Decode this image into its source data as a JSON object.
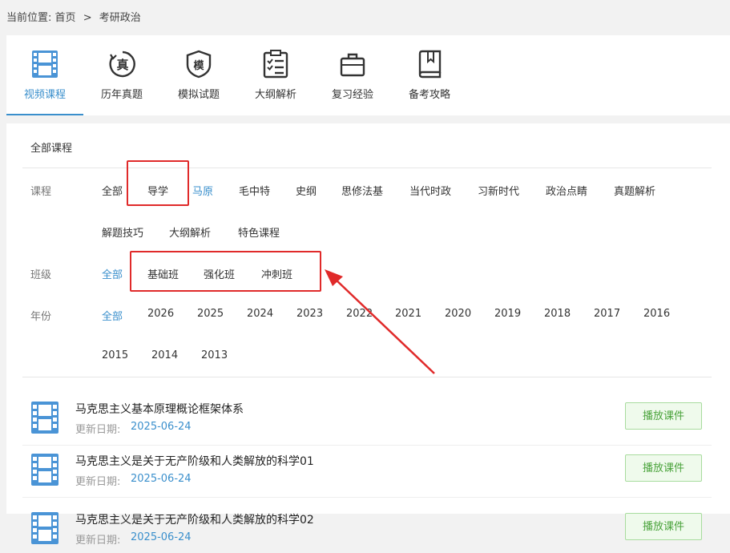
{
  "breadcrumb": {
    "prefix": "当前位置:",
    "home": "首页",
    "separator": ">",
    "current": "考研政治"
  },
  "tabs": [
    {
      "label": "视频课程",
      "icon": "film-icon",
      "active": true
    },
    {
      "label": "历年真题",
      "icon": "zhen-badge-icon"
    },
    {
      "label": "模拟试题",
      "icon": "mo-shield-icon"
    },
    {
      "label": "大纲解析",
      "icon": "checklist-icon"
    },
    {
      "label": "复习经验",
      "icon": "briefcase-icon"
    },
    {
      "label": "备考攻略",
      "icon": "book-icon"
    }
  ],
  "filters": {
    "all_courses": "全部课程",
    "course_label": "课程",
    "course_options": [
      "全部",
      "导学",
      "马原",
      "毛中特",
      "史纲",
      "思修法基",
      "当代时政",
      "习新时代",
      "政治点睛",
      "真题解析",
      "解题技巧",
      "大纲解析",
      "特色课程"
    ],
    "course_selected": "马原",
    "class_label": "班级",
    "class_options": [
      "全部",
      "基础班",
      "强化班",
      "冲刺班"
    ],
    "class_selected": "全部",
    "year_label": "年份",
    "year_options": [
      "全部",
      "2026",
      "2025",
      "2024",
      "2023",
      "2022",
      "2021",
      "2020",
      "2019",
      "2018",
      "2017",
      "2016",
      "2015",
      "2014",
      "2013"
    ],
    "year_selected": "全部"
  },
  "annotation_color": "#e02a2a",
  "accent_color": "#3a8fcc",
  "courses": [
    {
      "title": "马克思主义基本原理概论框架体系",
      "date_label": "更新日期:",
      "date": "2025-06-24",
      "button": "播放课件"
    },
    {
      "title": "马克思主义是关于无产阶级和人类解放的科学01",
      "date_label": "更新日期:",
      "date": "2025-06-24",
      "button": "播放课件"
    },
    {
      "title": "马克思主义是关于无产阶级和人类解放的科学02",
      "date_label": "更新日期:",
      "date": "2025-06-24",
      "button": "播放课件"
    }
  ]
}
